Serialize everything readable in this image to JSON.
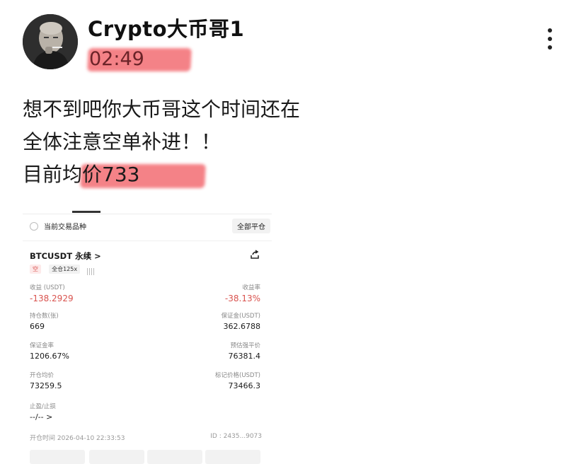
{
  "post": {
    "username": "Crypto大币哥1",
    "time": "02:49",
    "lines": [
      "想不到吧你大币哥这个时间还在",
      "全体注意空单补进！！",
      "目前均价733"
    ]
  },
  "colors": {
    "highlight": "#f25f66",
    "loss": "#d9534f"
  },
  "card": {
    "filter_label": "当前交易品种",
    "close_all_label": "全部平仓",
    "symbol": "BTCUSDT 永续 >",
    "tag_side": "空",
    "tag_margin": "全仓125x",
    "pnl_label": "收益 (USDT)",
    "pnl_value": "-138.2929",
    "roe_label": "收益率",
    "roe_value": "-38.13%",
    "size_label": "持仓数(张)",
    "size_value": "669",
    "margin_label": "保证金(USDT)",
    "margin_value": "362.6788",
    "margin_ratio_label": "保证金率",
    "margin_ratio_value": "1206.67%",
    "liq_label": "预估强平价",
    "liq_value": "76381.4",
    "entry_label": "开仓均价",
    "entry_value": "73259.5",
    "mark_label": "标记价格(USDT)",
    "mark_value": "73466.3",
    "tpsl_label": "止盈/止损",
    "tpsl_value": "--/-- >",
    "open_time": "开仓时间 2026-04-10 22:33:53",
    "position_id": "ID : 2435...9073"
  }
}
